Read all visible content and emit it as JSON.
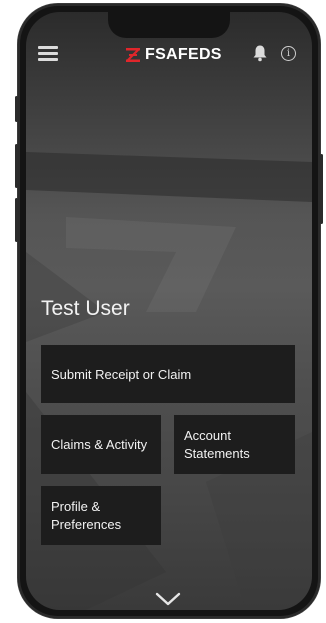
{
  "header": {
    "brand_name": "FSAFEDS",
    "menu_icon": "hamburger-menu-icon",
    "notification_icon": "bell-icon",
    "info_icon": "info-icon"
  },
  "main": {
    "user_name": "Test User",
    "tiles": [
      {
        "label": "Submit Receipt or Claim"
      },
      {
        "label": "Claims & Activity"
      },
      {
        "label": "Account Statements"
      },
      {
        "label": "Profile & Preferences"
      }
    ]
  },
  "footer": {
    "scroll_icon": "chevron-down-icon"
  },
  "colors": {
    "tile_bg": "#1d1d1d",
    "brand_red": "#e0262b",
    "text": "#f2f2f2"
  }
}
